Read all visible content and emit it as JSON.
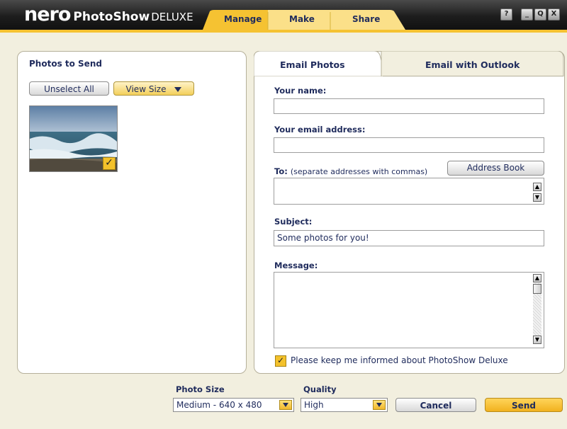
{
  "app": {
    "logo_nero": "nero",
    "logo_photoshow": "PhotoShow",
    "logo_deluxe": "DELUXE"
  },
  "nav_tabs": [
    {
      "label": "Manage",
      "active": true
    },
    {
      "label": "Make",
      "active": false
    },
    {
      "label": "Share",
      "active": false
    }
  ],
  "window_buttons": {
    "help": "?",
    "minimize": "_",
    "zoom": "Q",
    "close": "X"
  },
  "photos_panel": {
    "title": "Photos to Send",
    "unselect_all": "Unselect All",
    "view_size": "View Size",
    "photo_checked": true
  },
  "email_tabs": [
    {
      "label": "Email Photos",
      "active": true
    },
    {
      "label": "Email with Outlook",
      "active": false
    }
  ],
  "form": {
    "your_name_label": "Your name:",
    "your_name_value": "",
    "your_email_label": "Your email address:",
    "your_email_value": "",
    "to_label": "To:",
    "to_hint": "(separate addresses with commas)",
    "to_value": "",
    "address_book": "Address Book",
    "subject_label": "Subject:",
    "subject_value": "Some photos for you!",
    "message_label": "Message:",
    "message_value": "",
    "keep_informed_checked": true,
    "keep_informed_label": "Please keep me informed about PhotoShow Deluxe"
  },
  "footer": {
    "photo_size_label": "Photo Size",
    "photo_size_value": "Medium - 640 x 480",
    "quality_label": "Quality",
    "quality_value": "High",
    "cancel": "Cancel",
    "send": "Send"
  },
  "colors": {
    "accent": "#f5c232",
    "title_text": "#1f2b5c",
    "background": "#f2efdf"
  }
}
